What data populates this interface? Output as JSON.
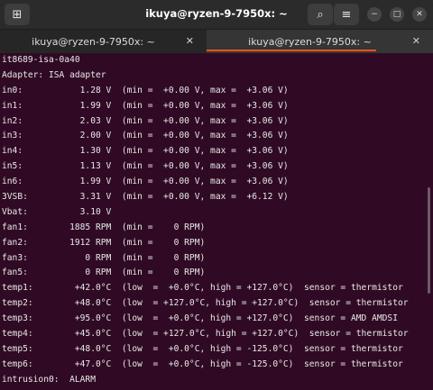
{
  "window": {
    "title": "ikuya@ryzen-9-7950x: ~",
    "controls": {
      "new_tab": "⊞",
      "search": "⌕",
      "menu": "≡",
      "minimize": "−",
      "maximize": "□",
      "close": "✕"
    }
  },
  "tabs": [
    {
      "label": "ikuya@ryzen-9-7950x: ~",
      "close": "✕",
      "active": false
    },
    {
      "label": "ikuya@ryzen-9-7950x: ~",
      "close": "✕",
      "active": true
    }
  ],
  "colors": {
    "terminal_bg": "#300a24",
    "accent": "#e95420",
    "text": "#e8e8e8"
  },
  "terminal": {
    "lines": [
      "it8689-isa-0a40",
      "Adapter: ISA adapter",
      "in0:           1.28 V  (min =  +0.00 V, max =  +3.06 V)",
      "in1:           1.99 V  (min =  +0.00 V, max =  +3.06 V)",
      "in2:           2.03 V  (min =  +0.00 V, max =  +3.06 V)",
      "in3:           2.00 V  (min =  +0.00 V, max =  +3.06 V)",
      "in4:           1.30 V  (min =  +0.00 V, max =  +3.06 V)",
      "in5:           1.13 V  (min =  +0.00 V, max =  +3.06 V)",
      "in6:           1.99 V  (min =  +0.00 V, max =  +3.06 V)",
      "3VSB:          3.31 V  (min =  +0.00 V, max =  +6.12 V)",
      "Vbat:          3.10 V",
      "fan1:        1885 RPM  (min =    0 RPM)",
      "fan2:        1912 RPM  (min =    0 RPM)",
      "fan3:           0 RPM  (min =    0 RPM)",
      "fan5:           0 RPM  (min =    0 RPM)",
      "temp1:        +42.0°C  (low  =  +0.0°C, high = +127.0°C)  sensor = thermistor",
      "temp2:        +48.0°C  (low  = +127.0°C, high = +127.0°C)  sensor = thermistor",
      "temp3:        +95.0°C  (low  =  +0.0°C, high = +127.0°C)  sensor = AMD AMDSI",
      "temp4:        +45.0°C  (low  = +127.0°C, high = +127.0°C)  sensor = thermistor",
      "temp5:        +48.0°C  (low  =  +0.0°C, high = -125.0°C)  sensor = thermistor",
      "temp6:        +47.0°C  (low  =  +0.0°C, high = -125.0°C)  sensor = thermistor",
      "intrusion0:  ALARM"
    ]
  }
}
